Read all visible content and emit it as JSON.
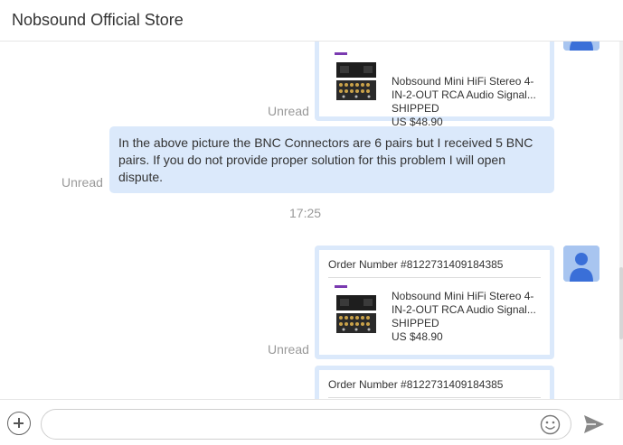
{
  "header": {
    "title": "Nobsound Official Store"
  },
  "messages": {
    "card1": {
      "product_name": "Nobsound Mini HiFi Stereo 4-IN-2-OUT RCA Audio Signal...",
      "status": "SHIPPED",
      "price": "US $48.90",
      "unread": "Unread"
    },
    "text_message": {
      "text": "In the above picture the BNC Connectors are 6 pairs but I received 5 BNC pairs. If you do not provide proper solution for this problem I will open dispute.",
      "unread": "Unread"
    },
    "timestamp": "17:25",
    "card2": {
      "order_number": "Order Number #8122731409184385",
      "product_name": "Nobsound Mini HiFi Stereo 4-IN-2-OUT RCA Audio Signal...",
      "status": "SHIPPED",
      "price": "US $48.90",
      "unread": "Unread"
    },
    "card3": {
      "order_number": "Order Number #8122731409184385"
    }
  },
  "composer": {
    "placeholder": ""
  },
  "colors": {
    "bubble": "#dbe9fb",
    "avatar": "#a8c5f0",
    "avatar_figure": "#3a6fd8",
    "muted_text": "#999999"
  },
  "icons": [
    "plus-icon",
    "emoji-icon",
    "send-icon",
    "user-icon"
  ]
}
